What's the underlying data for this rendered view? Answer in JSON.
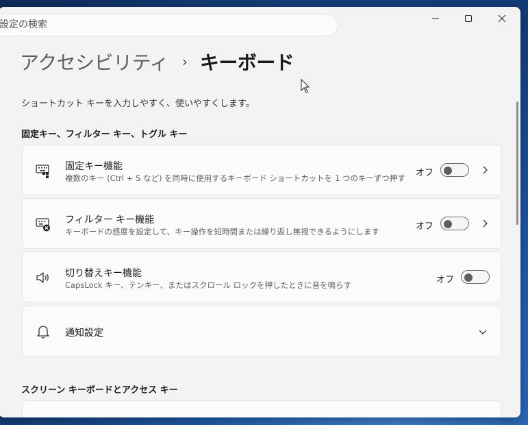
{
  "search": {
    "placeholder": "設定の検索",
    "display_text": "設定の検索"
  },
  "window_controls": {
    "minimize": "minimize-icon",
    "maximize": "maximize-icon",
    "close": "close-icon"
  },
  "breadcrumb": {
    "parent": "アクセシビリティ",
    "separator": "›",
    "current": "キーボード"
  },
  "description": "ショートカット キーを入力しやすく、使いやすくします。",
  "sections": [
    {
      "title": "固定キー、フィルター キー、トグル キー"
    },
    {
      "title": "スクリーン キーボードとアクセス キー"
    }
  ],
  "cards": [
    {
      "title": "固定キー機能",
      "subtitle": "複数のキー (Ctrl + S など) を同時に使用するキーボード ショートカットを 1 つのキーずつ押す",
      "toggle_label": "オフ",
      "toggle_on": false,
      "icon": "sticky-keys-icon",
      "has_chevron": true
    },
    {
      "title": "フィルター キー機能",
      "subtitle": "キーボードの感度を設定して、キー操作を短時間または繰り返し無視できるようにします",
      "toggle_label": "オフ",
      "toggle_on": false,
      "icon": "filter-keys-icon",
      "has_chevron": true
    },
    {
      "title": "切り替えキー機能",
      "subtitle": "CapsLock キー、テンキー、またはスクロール ロックを押したときに音を鳴らす",
      "toggle_label": "オフ",
      "toggle_on": false,
      "icon": "speaker-icon",
      "has_chevron": false
    },
    {
      "title": "通知設定",
      "icon": "bell-icon",
      "expand_icon": "chevron-down-icon"
    }
  ],
  "colors": {
    "accent": "#0067c0",
    "window_bg": "#f3f3f3",
    "card_bg": "#fbfbfb"
  }
}
